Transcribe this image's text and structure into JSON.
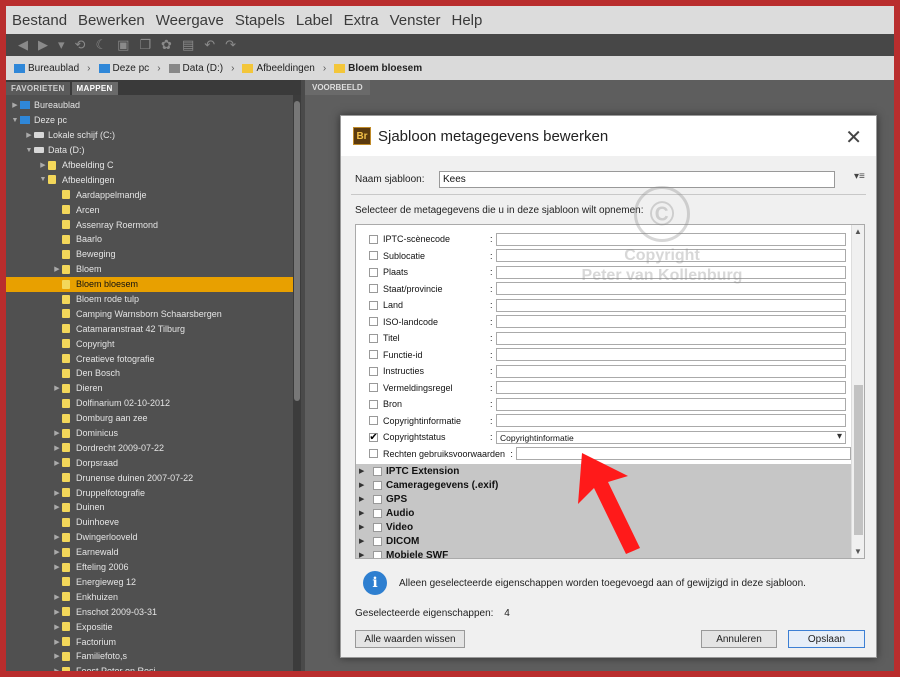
{
  "menu": [
    "Bestand",
    "Bewerken",
    "Weergave",
    "Stapels",
    "Label",
    "Extra",
    "Venster",
    "Help"
  ],
  "toolbar": {
    "icons": [
      "back-arrow-icon",
      "forward-arrow-icon",
      "dropdown-icon",
      "recent-icon",
      "boomerang-icon",
      "camera-icon",
      "stack-icon",
      "refine-icon",
      "open-icon",
      "rotate-left-icon",
      "rotate-right-icon"
    ]
  },
  "breadcrumb": [
    "Bureaublad",
    "Deze pc",
    "Data (D:)",
    "Afbeeldingen",
    "Bloem bloesem"
  ],
  "panel_tabs": {
    "favorites": "FAVORIETEN",
    "folders": "MAPPEN",
    "preview": "VOORBEELD"
  },
  "tree": [
    {
      "label": "Bureaublad",
      "level": 0,
      "icon": "pc",
      "expanded": false
    },
    {
      "label": "Deze pc",
      "level": 0,
      "icon": "pc",
      "expanded": true
    },
    {
      "label": "Lokale schijf (C:)",
      "level": 1,
      "icon": "drive",
      "expanded": false
    },
    {
      "label": "Data (D:)",
      "level": 1,
      "icon": "drive",
      "expanded": true
    },
    {
      "label": "Afbeelding C",
      "level": 2,
      "icon": "folder",
      "expanded": false
    },
    {
      "label": "Afbeeldingen",
      "level": 2,
      "icon": "folder",
      "expanded": true
    },
    {
      "label": "Aardappelmandje",
      "level": 3,
      "icon": "folder"
    },
    {
      "label": "Arcen",
      "level": 3,
      "icon": "folder"
    },
    {
      "label": "Assenray Roermond",
      "level": 3,
      "icon": "folder"
    },
    {
      "label": "Baarlo",
      "level": 3,
      "icon": "folder"
    },
    {
      "label": "Beweging",
      "level": 3,
      "icon": "folder"
    },
    {
      "label": "Bloem",
      "level": 3,
      "icon": "folder",
      "expandable": true
    },
    {
      "label": "Bloem bloesem",
      "level": 3,
      "icon": "folder",
      "selected": true
    },
    {
      "label": "Bloem rode tulp",
      "level": 3,
      "icon": "folder"
    },
    {
      "label": "Camping Warnsborn Schaarsbergen",
      "level": 3,
      "icon": "folder"
    },
    {
      "label": "Catamaranstraat 42 Tilburg",
      "level": 3,
      "icon": "folder"
    },
    {
      "label": "Copyright",
      "level": 3,
      "icon": "folder"
    },
    {
      "label": "Creatieve fotografie",
      "level": 3,
      "icon": "folder"
    },
    {
      "label": "Den Bosch",
      "level": 3,
      "icon": "folder"
    },
    {
      "label": "Dieren",
      "level": 3,
      "icon": "folder",
      "expandable": true
    },
    {
      "label": "Dolfinarium 02-10-2012",
      "level": 3,
      "icon": "folder"
    },
    {
      "label": "Domburg aan zee",
      "level": 3,
      "icon": "folder"
    },
    {
      "label": "Dominicus",
      "level": 3,
      "icon": "folder",
      "expandable": true
    },
    {
      "label": "Dordrecht 2009-07-22",
      "level": 3,
      "icon": "folder",
      "expandable": true
    },
    {
      "label": "Dorpsraad",
      "level": 3,
      "icon": "folder",
      "expandable": true
    },
    {
      "label": "Drunense duinen 2007-07-22",
      "level": 3,
      "icon": "folder"
    },
    {
      "label": "Druppelfotografie",
      "level": 3,
      "icon": "folder",
      "expandable": true
    },
    {
      "label": "Duinen",
      "level": 3,
      "icon": "folder",
      "expandable": true
    },
    {
      "label": "Duinhoeve",
      "level": 3,
      "icon": "folder"
    },
    {
      "label": "Dwingerlooveld",
      "level": 3,
      "icon": "folder",
      "expandable": true
    },
    {
      "label": "Earnewald",
      "level": 3,
      "icon": "folder",
      "expandable": true
    },
    {
      "label": "Efteling 2006",
      "level": 3,
      "icon": "folder",
      "expandable": true
    },
    {
      "label": "Energieweg 12",
      "level": 3,
      "icon": "folder"
    },
    {
      "label": "Enkhuizen",
      "level": 3,
      "icon": "folder",
      "expandable": true
    },
    {
      "label": "Enschot 2009-03-31",
      "level": 3,
      "icon": "folder",
      "expandable": true
    },
    {
      "label": "Expositie",
      "level": 3,
      "icon": "folder",
      "expandable": true
    },
    {
      "label": "Factorium",
      "level": 3,
      "icon": "folder",
      "expandable": true
    },
    {
      "label": "Familiefoto,s",
      "level": 3,
      "icon": "folder",
      "expandable": true
    },
    {
      "label": "Feest Peter en Resi",
      "level": 3,
      "icon": "folder",
      "expandable": true
    }
  ],
  "dialog": {
    "title": "Sjabloon metagegevens bewerken",
    "app_badge": "Br",
    "name_label": "Naam sjabloon:",
    "name_value": "Kees",
    "instruction": "Selecteer de metagegevens die u in deze sjabloon wilt opnemen:",
    "fields": [
      {
        "label": "IPTC-scènecode",
        "checked": false,
        "value": ""
      },
      {
        "label": "Sublocatie",
        "checked": false,
        "value": ""
      },
      {
        "label": "Plaats",
        "checked": false,
        "value": ""
      },
      {
        "label": "Staat/provincie",
        "checked": false,
        "value": ""
      },
      {
        "label": "Land",
        "checked": false,
        "value": ""
      },
      {
        "label": "ISO-landcode",
        "checked": false,
        "value": ""
      },
      {
        "label": "Titel",
        "checked": false,
        "value": ""
      },
      {
        "label": "Functie-id",
        "checked": false,
        "value": ""
      },
      {
        "label": "Instructies",
        "checked": false,
        "value": ""
      },
      {
        "label": "Vermeldingsregel",
        "checked": false,
        "value": ""
      },
      {
        "label": "Bron",
        "checked": false,
        "value": ""
      },
      {
        "label": "Copyrightinformatie",
        "checked": false,
        "value": ""
      },
      {
        "label": "Copyrightstatus",
        "checked": true,
        "value": "Copyrightinformatie",
        "dropdown": true
      },
      {
        "label": "Rechten gebruiksvoorwaarden",
        "checked": false,
        "value": ""
      }
    ],
    "groups": [
      "IPTC Extension",
      "Cameragegevens (.exif)",
      "GPS",
      "Audio",
      "Video",
      "DICOM",
      "Mobiele SWF"
    ],
    "info_text": "Alleen geselecteerde eigenschappen worden toegevoegd aan of gewijzigd in deze sjabloon.",
    "selected_label": "Geselecteerde eigenschappen:",
    "selected_count": "4",
    "clear_button": "Alle waarden wissen",
    "cancel_button": "Annuleren",
    "save_button": "Opslaan"
  },
  "watermark": {
    "symbol": "©",
    "line1": "Copyright",
    "line2": "Peter van Kollenburg"
  },
  "colors": {
    "frame": "#b92d2d",
    "selected_row": "#e8a000",
    "folder": "#f3d75a",
    "arrow": "#ff1a1a",
    "primary_border": "#3c7fd4"
  }
}
